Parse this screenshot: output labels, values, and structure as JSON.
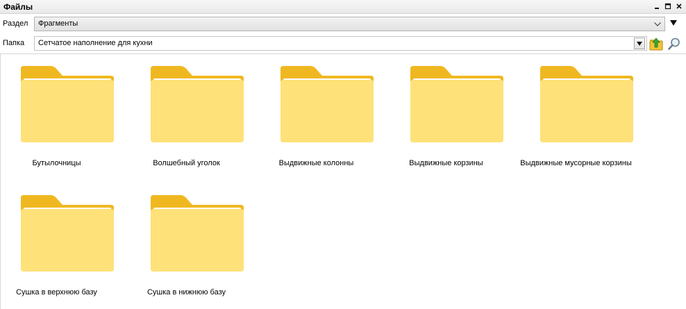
{
  "window": {
    "title": "Файлы"
  },
  "section": {
    "label": "Раздел",
    "value": "Фрагменты"
  },
  "folder": {
    "label": "Папка",
    "value": "Сетчатое наполнение для кухни"
  },
  "icons": {
    "minimize": "minimize-icon",
    "maximize": "maximize-icon",
    "close": "close-icon",
    "dropdown": "chevron-down-icon",
    "up": "folder-up-icon",
    "search": "magnifier-icon",
    "item": "folder-icon"
  },
  "colors": {
    "folder_front": "#ffd750",
    "folder_back": "#f0b820",
    "paper": "#ffffff",
    "up_arrow": "#3aa832"
  },
  "items": [
    {
      "name": "Бутылочницы"
    },
    {
      "name": "Волшебный уголок"
    },
    {
      "name": "Выдвижные колонны"
    },
    {
      "name": "Выдвижные корзины"
    },
    {
      "name": "Выдвижные мусорные корзины"
    },
    {
      "name": "Сушка в верхнюю базу"
    },
    {
      "name": "Сушка в нижнюю базу"
    }
  ]
}
